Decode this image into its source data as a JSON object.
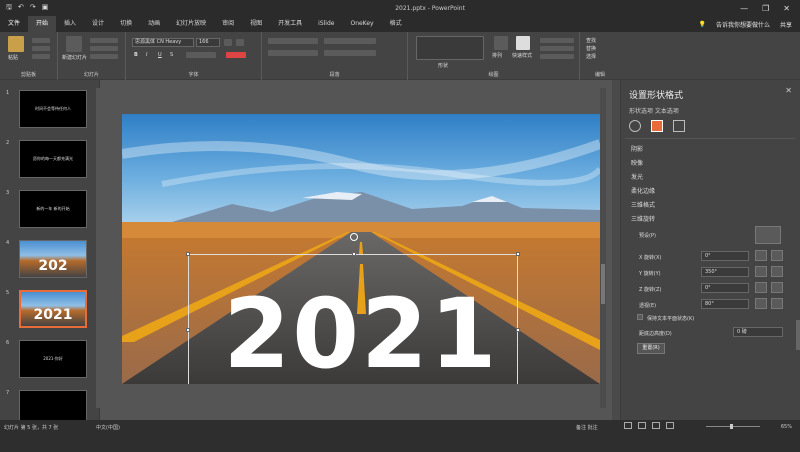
{
  "app": {
    "title": "2021.pptx - PowerPoint",
    "accent": "#e86b3a"
  },
  "qat": {
    "save_icon": "save-icon",
    "undo_icon": "undo-icon",
    "redo_icon": "redo-icon",
    "start_icon": "present-icon"
  },
  "window": {
    "minimize": "—",
    "restore": "❐",
    "close": "✕"
  },
  "tabs": [
    {
      "label": "文件"
    },
    {
      "label": "开始"
    },
    {
      "label": "插入"
    },
    {
      "label": "设计"
    },
    {
      "label": "切换"
    },
    {
      "label": "动画"
    },
    {
      "label": "幻灯片放映"
    },
    {
      "label": "审阅"
    },
    {
      "label": "视图"
    },
    {
      "label": "开发工具"
    },
    {
      "label": "iSlide"
    },
    {
      "label": "OneKey"
    },
    {
      "label": "格式"
    }
  ],
  "tab_right": {
    "tell": "告诉我你想要做什么",
    "share": "共享"
  },
  "ribbon": {
    "groups": [
      {
        "label": "剪贴板"
      },
      {
        "label": "幻灯片"
      },
      {
        "label": "字体"
      },
      {
        "label": "段落"
      },
      {
        "label": "绘图"
      },
      {
        "label": "编辑"
      }
    ],
    "paste": "粘贴",
    "new_slide": "新建幻灯片",
    "font_name": "思源黑体 CN Heavy",
    "font_size": "166",
    "shapes": "形状",
    "arrange": "排列",
    "quick_styles": "快速样式",
    "find": "查找",
    "replace": "替换",
    "select": "选择"
  },
  "thumbnails": {
    "items": [
      {
        "num": "1",
        "kind": "text",
        "text": "时间不会等待任何人"
      },
      {
        "num": "2",
        "kind": "text",
        "text": "愿你的每一天都充满光"
      },
      {
        "num": "3",
        "kind": "text",
        "text": "新的一年 新的开始"
      },
      {
        "num": "4",
        "kind": "road",
        "text": "202"
      },
      {
        "num": "5",
        "kind": "road",
        "text": "2021"
      },
      {
        "num": "6",
        "kind": "text",
        "text": "2021·你好"
      },
      {
        "num": "7",
        "kind": "text",
        "text": ""
      }
    ],
    "selected": 5
  },
  "slide": {
    "big_text": "2021",
    "text_color": "#ffffff"
  },
  "pane": {
    "title": "设置形状格式",
    "subtitle": "形状选项   文本选项",
    "sections": [
      {
        "label": "阴影"
      },
      {
        "label": "映像"
      },
      {
        "label": "发光"
      },
      {
        "label": "柔化边缘"
      },
      {
        "label": "三维格式"
      },
      {
        "label": "三维旋转"
      }
    ],
    "fields": {
      "preset": "预设(P)",
      "x_rot": "X 旋转(X)",
      "y_rot": "Y 旋转(Y)",
      "z_rot": "Z 旋转(Z)",
      "perspective": "透视(E)",
      "keep_flat": "保持文本平面状态(K)",
      "dist": "距底边高度(D)",
      "x_val": "0°",
      "y_val": "350°",
      "z_val": "0°",
      "persp_val": "80°",
      "dist_val": "0 磅",
      "reset": "重置(R)"
    }
  },
  "status": {
    "slide_info": "幻灯片 第 5 张，共 7 张",
    "lang": "中文(中国)",
    "notes": "备注  批注",
    "zoom": "65%"
  }
}
